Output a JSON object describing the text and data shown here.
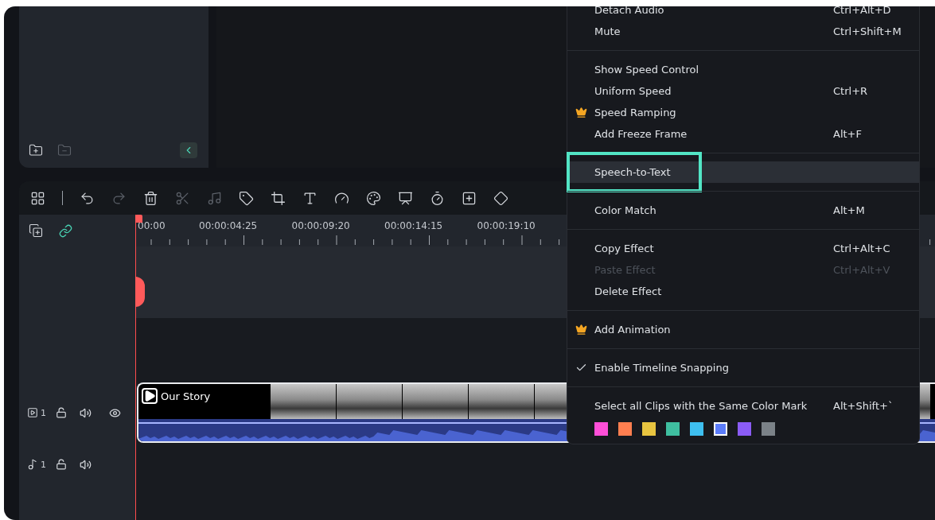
{
  "media_panel": {
    "buttons": [
      {
        "kind": "folder-add",
        "disabled": false
      },
      {
        "kind": "folder-remove",
        "disabled": true
      },
      {
        "kind": "collapse",
        "disabled": false
      }
    ]
  },
  "toolbar": [
    {
      "kind": "layout",
      "disabled": false
    },
    {
      "kind": "divider",
      "disabled": false
    },
    {
      "kind": "undo",
      "disabled": false
    },
    {
      "kind": "redo",
      "disabled": true
    },
    {
      "kind": "delete",
      "disabled": false
    },
    {
      "kind": "cut",
      "disabled": true
    },
    {
      "kind": "audio",
      "disabled": true
    },
    {
      "kind": "tag",
      "disabled": false
    },
    {
      "kind": "crop",
      "disabled": false
    },
    {
      "kind": "text",
      "disabled": false
    },
    {
      "kind": "speed",
      "disabled": false
    },
    {
      "kind": "color",
      "disabled": false
    },
    {
      "kind": "record",
      "disabled": false
    },
    {
      "kind": "timer",
      "disabled": false
    },
    {
      "kind": "frame",
      "disabled": false
    },
    {
      "kind": "keyframe",
      "disabled": false
    }
  ],
  "ruler": {
    "labels": [
      "00:00",
      "00:00:04:25",
      "00:00:09:20",
      "00:00:14:15",
      "00:00:19:10"
    ]
  },
  "tracks": [
    {
      "kind": "video",
      "number": "1",
      "locked": false,
      "muted": false,
      "visible": true
    },
    {
      "kind": "audio",
      "number": "1",
      "locked": false,
      "muted": false
    }
  ],
  "clip": {
    "title": "Our Story"
  },
  "context_menu": {
    "groups": [
      [
        {
          "label": "Detach Audio",
          "shortcut": "Ctrl+Alt+D",
          "selected": false,
          "disabled": false,
          "premium": false,
          "checked": false
        },
        {
          "label": "Mute",
          "shortcut": "Ctrl+Shift+M",
          "selected": false,
          "disabled": false,
          "premium": false,
          "checked": false
        }
      ],
      [
        {
          "label": "Show Speed Control",
          "selected": false,
          "disabled": false,
          "premium": false,
          "checked": false
        },
        {
          "label": "Uniform Speed",
          "shortcut": "Ctrl+R",
          "selected": false,
          "disabled": false,
          "premium": false,
          "checked": false
        },
        {
          "label": "Speed Ramping",
          "selected": false,
          "disabled": false,
          "premium": true,
          "checked": false
        },
        {
          "label": "Add Freeze Frame",
          "shortcut": "Alt+F",
          "selected": false,
          "disabled": false,
          "premium": false,
          "checked": false
        }
      ],
      [
        {
          "label": "Speech-to-Text",
          "selected": true,
          "disabled": false,
          "premium": false,
          "checked": false,
          "framed": true
        }
      ],
      [
        {
          "label": "Color Match",
          "shortcut": "Alt+M",
          "selected": false,
          "disabled": false,
          "premium": false,
          "checked": false
        }
      ],
      [
        {
          "label": "Copy Effect",
          "shortcut": "Ctrl+Alt+C",
          "selected": false,
          "disabled": false,
          "premium": false,
          "checked": false
        },
        {
          "label": "Paste Effect",
          "shortcut": "Ctrl+Alt+V",
          "selected": false,
          "disabled": true,
          "premium": false,
          "checked": false
        },
        {
          "label": "Delete Effect",
          "selected": false,
          "disabled": false,
          "premium": false,
          "checked": false
        }
      ],
      [
        {
          "label": "Add Animation",
          "selected": false,
          "disabled": false,
          "premium": true,
          "checked": false
        }
      ],
      [
        {
          "label": "Enable Timeline Snapping",
          "selected": false,
          "disabled": false,
          "premium": false,
          "checked": true
        }
      ],
      [
        {
          "label": "Select all Clips with the Same Color Mark",
          "shortcut": "Alt+Shift+`",
          "selected": false,
          "disabled": false,
          "premium": false,
          "checked": false
        }
      ]
    ],
    "color_marks": [
      {
        "color": "#ff4fd8",
        "selected": false
      },
      {
        "color": "#ff7f50",
        "selected": false
      },
      {
        "color": "#e8c440",
        "selected": false
      },
      {
        "color": "#3fbfa0",
        "selected": false
      },
      {
        "color": "#3ebff0",
        "selected": false
      },
      {
        "color": "#5b7cfa",
        "selected": true
      },
      {
        "color": "#8b5cf6",
        "selected": false
      },
      {
        "color": "#7b8288",
        "selected": false
      }
    ]
  }
}
